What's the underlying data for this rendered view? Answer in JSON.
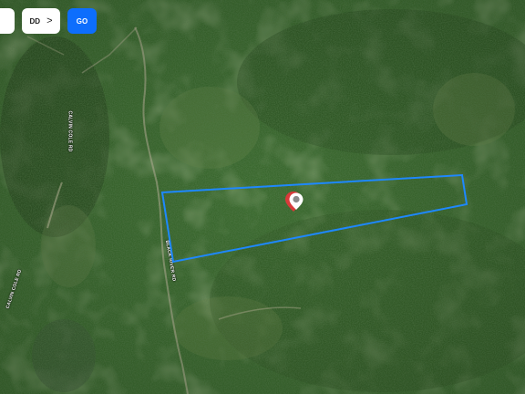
{
  "toolbar": {
    "blank_label": "",
    "dd_label": "DD",
    "dd_chevron": ">",
    "go_label": "GO"
  },
  "map": {
    "roads": [
      {
        "name": "CALVIN COLE RD"
      },
      {
        "name": "CALVIN COLE RD"
      },
      {
        "name": "BLACK RIVER RD"
      }
    ],
    "boundary_color": "#1e88ff",
    "marker_color": "#d83a3a"
  }
}
